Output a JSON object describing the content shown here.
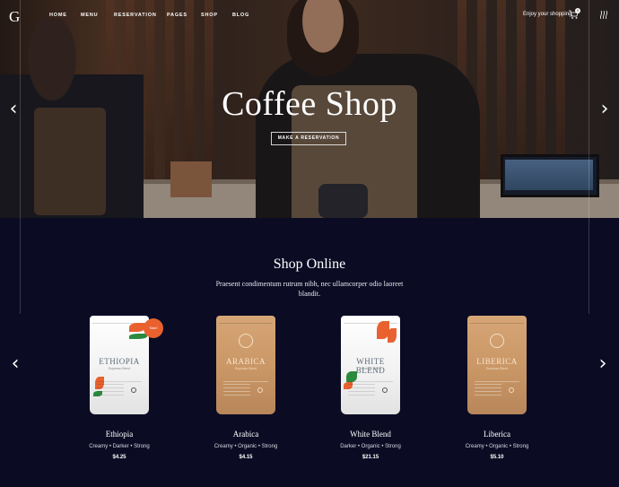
{
  "brand": {
    "logo_letter": "G"
  },
  "nav": {
    "items": [
      "HOME",
      "MENU",
      "RESERVATION",
      "PAGES",
      "SHOP",
      "BLOG"
    ],
    "enjoy": "Enjoy your shopping",
    "cart_count": "0"
  },
  "hero": {
    "title": "Coffee Shop",
    "button": "MAKE A RESERVATION"
  },
  "shop": {
    "title": "Shop Online",
    "subtitle": "Praesent condimentum rutrum nibh, nec ullamcorper odio laoreet blandit.",
    "badge": "Sale!",
    "products": [
      {
        "name": "Ethiopia",
        "bag_title": "ETHIOPIA",
        "bag_sub": "Espresso Blend",
        "tags": "Creamy  •  Darker  •  Strong",
        "price": "$4.25",
        "style": "white"
      },
      {
        "name": "Arabica",
        "bag_title": "ARABICA",
        "bag_sub": "Espresso Blend",
        "tags": "Creamy  •  Organic  •  Strong",
        "price": "$4.15",
        "style": "kraft"
      },
      {
        "name": "White Blend",
        "bag_title": "WHITE BLEND",
        "bag_sub": "Espresso Blend",
        "tags": "Darker  •  Organic  •  Strong",
        "price": "$21.15",
        "style": "white"
      },
      {
        "name": "Liberica",
        "bag_title": "LIBERICA",
        "bag_sub": "Espresso Blend",
        "tags": "Creamy  •  Organic  •  Strong",
        "price": "$5.10",
        "style": "kraft"
      }
    ]
  },
  "colors": {
    "page_bg": "#0b0c24",
    "accent": "#e8612f",
    "kraft": "#c99665"
  },
  "icons": [
    "cart-icon",
    "steam-icon",
    "arrow-left-icon",
    "arrow-right-icon"
  ]
}
